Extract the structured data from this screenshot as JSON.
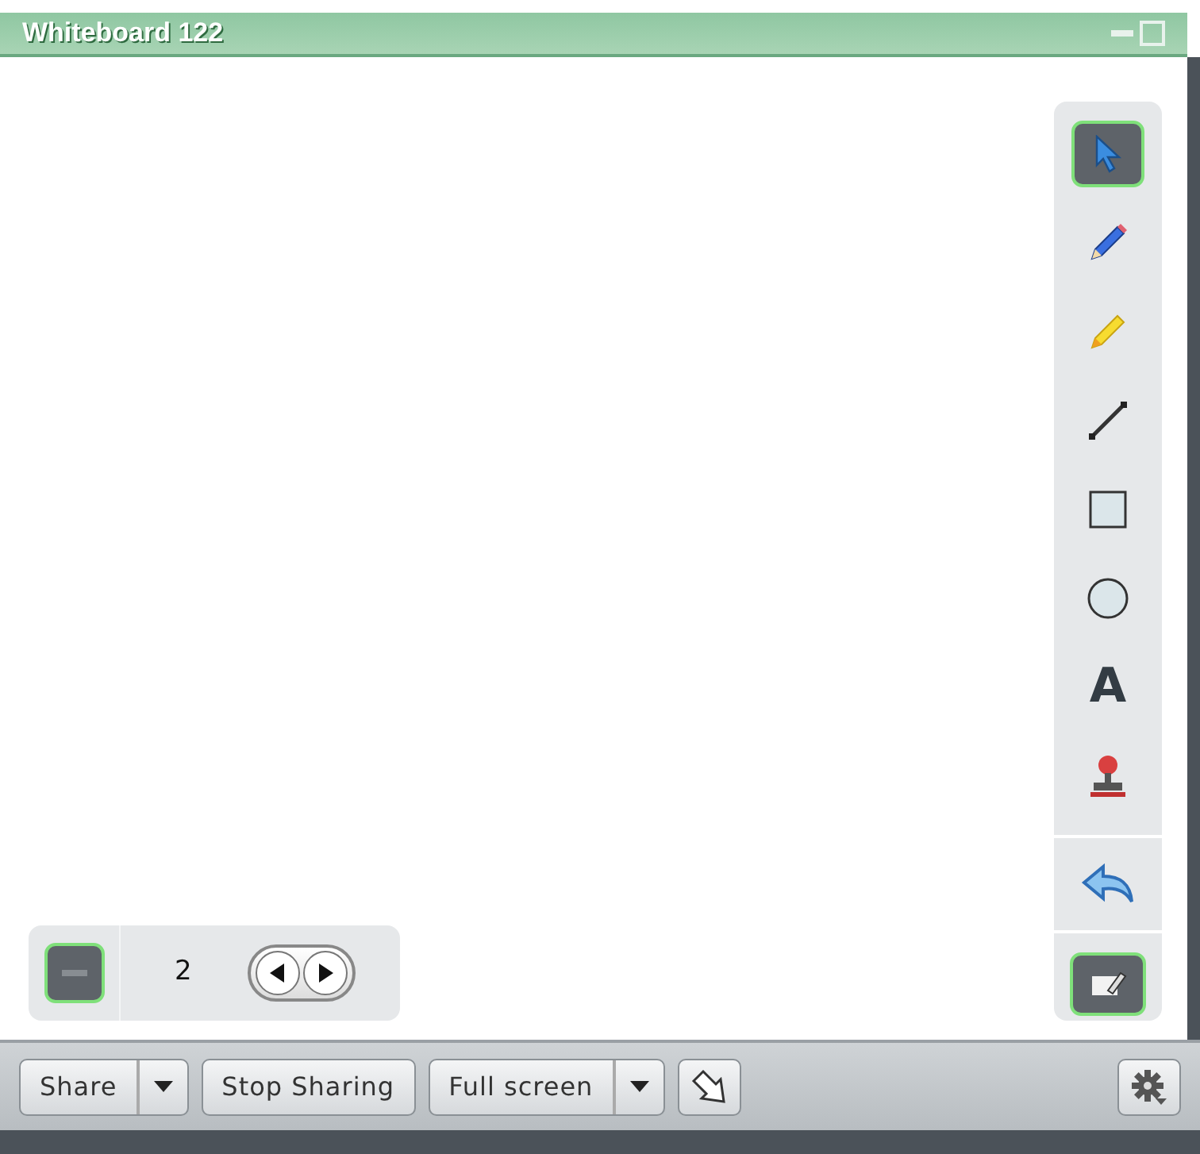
{
  "window": {
    "title": "Whiteboard 122"
  },
  "tools": [
    {
      "kind": "pointer",
      "selected": true
    },
    {
      "kind": "pen",
      "selected": false
    },
    {
      "kind": "highlighter",
      "selected": false
    },
    {
      "kind": "line",
      "selected": false
    },
    {
      "kind": "rectangle",
      "selected": false
    },
    {
      "kind": "ellipse",
      "selected": false
    },
    {
      "kind": "text",
      "label": "A",
      "selected": false
    },
    {
      "kind": "stamp",
      "selected": false
    }
  ],
  "undo": {
    "enabled": true
  },
  "edit_toggle": {
    "on": true
  },
  "pages": {
    "collapse_on": true,
    "current": "2"
  },
  "bottom_bar": {
    "buttons": [
      {
        "label": "Share",
        "dropdown": true
      },
      {
        "label": "Stop Sharing",
        "dropdown": false
      },
      {
        "label": "Full screen",
        "dropdown": true
      }
    ]
  }
}
